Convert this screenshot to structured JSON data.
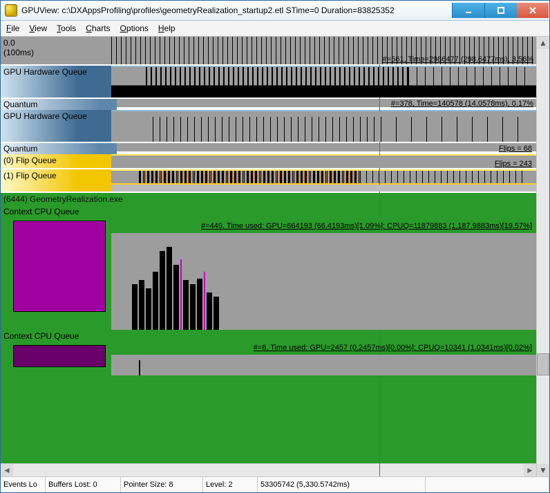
{
  "window": {
    "title": "GPUView: c:\\DXAppsProfiling\\profiles\\geometryRealization_startup2.etl STime=0 Duration=83825352"
  },
  "menu": {
    "file": "File",
    "view": "View",
    "tools": "Tools",
    "charts": "Charts",
    "options": "Options",
    "help": "Help"
  },
  "ruler": {
    "start": "0.0",
    "step": "(100ms)"
  },
  "hwq1": {
    "title": "GPU Hardware Queue",
    "info": "#=561,  Time=2986477 (298.6477ms),  3.56%",
    "quantum": "Quantum"
  },
  "hwq2": {
    "title": "GPU Hardware Queue",
    "info": "#=378,  Time=140578 (14.0578ms),  0.17%",
    "quantum": "Quantum"
  },
  "flip0": {
    "title": "(0) Flip Queue",
    "info": "Flips = 68"
  },
  "flip1": {
    "title": "(1) Flip Queue",
    "info": "Flips = 243"
  },
  "proc": {
    "name": "(6444) GeometryRealization.exe",
    "ctx1": {
      "label": "Context CPU Queue",
      "info": "#=449, Time used: GPU=664193 (66.4193ms)[1.09%]; CPUQ=11879883 (1,187.9883ms)[19.57%]"
    },
    "ctx2": {
      "label": "Context CPU Queue",
      "info": "#=8, Time used: GPU=2457 (0.2457ms)[0.00%]; CPUQ=10341 (1.0341ms)[0.02%]"
    }
  },
  "status": {
    "events": "Events Lo",
    "buffers": "Buffers Lost: 0",
    "pointer": "Pointer Size: 8",
    "level": "Level: 2",
    "time": "53305742 (5,330.5742ms)"
  }
}
